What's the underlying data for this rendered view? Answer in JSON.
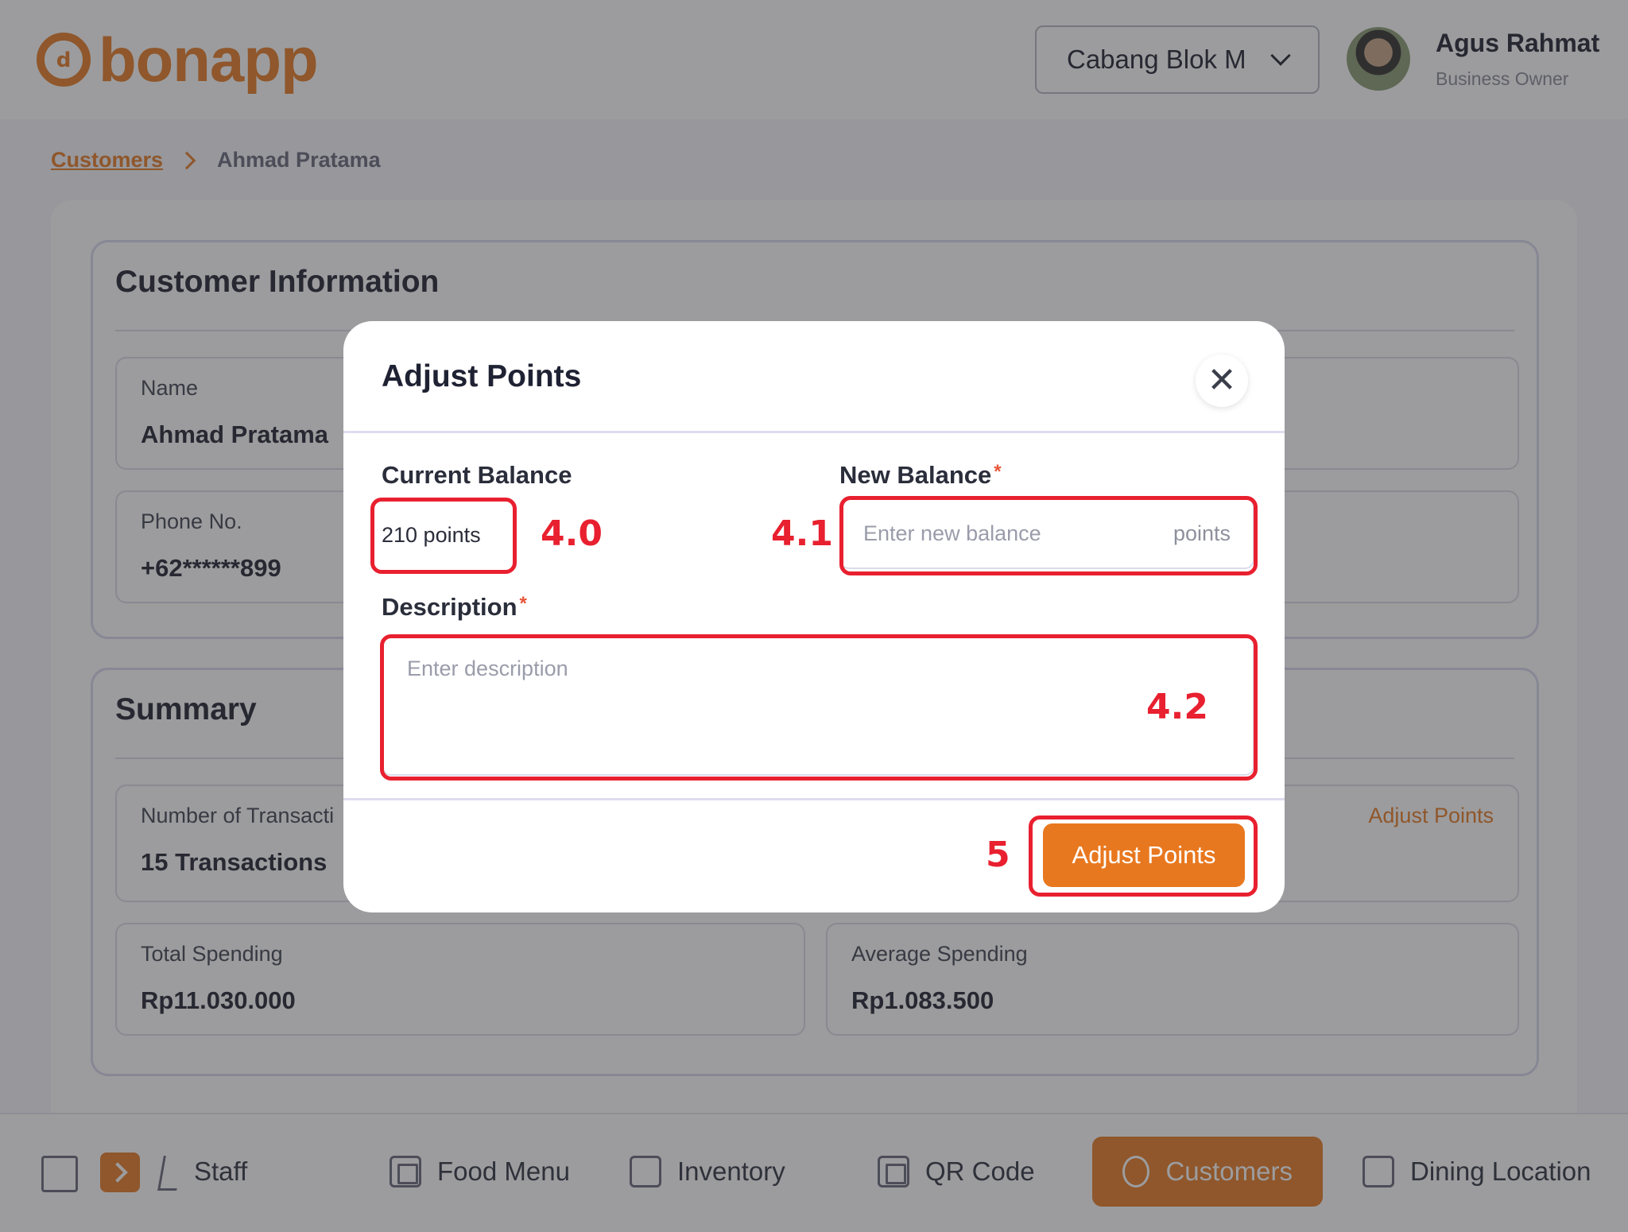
{
  "app": {
    "logo_text": "bonapp",
    "branch": "Cabang Blok M",
    "user_name": "Agus Rahmat",
    "user_role": "Business Owner"
  },
  "breadcrumb": {
    "parent": "Customers",
    "current": "Ahmad Pratama"
  },
  "customer_info": {
    "title": "Customer Information",
    "name_label": "Name",
    "name_value": "Ahmad Pratama",
    "phone_label": "Phone No.",
    "phone_value": "+62******899"
  },
  "summary": {
    "title": "Summary",
    "transactions_label": "Number of Transacti",
    "transactions_value": "15 Transactions",
    "adjust_link": "Adjust Points",
    "total_label": "Total Spending",
    "total_value": "Rp11.030.000",
    "avg_label": "Average Spending",
    "avg_value": "Rp1.083.500"
  },
  "modal": {
    "title": "Adjust Points",
    "close_glyph": "✕",
    "current_balance_label": "Current Balance",
    "current_balance_value": "210 points",
    "new_balance_label": "New Balance",
    "required_mark": "*",
    "new_balance_placeholder": "Enter new balance",
    "new_balance_suffix": "points",
    "description_label": "Description",
    "description_placeholder": "Enter description",
    "submit_label": "Adjust Points"
  },
  "annotations": {
    "current_balance": "4.0",
    "new_balance": "4.1",
    "description": "4.2",
    "submit": "5"
  },
  "bottom_nav": {
    "items": [
      {
        "label": "Staff",
        "icon": "staff-icon"
      },
      {
        "label": "Food Menu",
        "icon": "food-menu-icon"
      },
      {
        "label": "Inventory",
        "icon": "inventory-icon"
      },
      {
        "label": "QR Code",
        "icon": "qr-code-icon"
      },
      {
        "label": "Customers",
        "icon": "customers-icon",
        "active": true
      },
      {
        "label": "Dining Location",
        "icon": "dining-location-icon"
      }
    ]
  },
  "colors": {
    "brand": "#e8812f",
    "primary_button": "#e8781f",
    "annotation": "#e8202f"
  }
}
